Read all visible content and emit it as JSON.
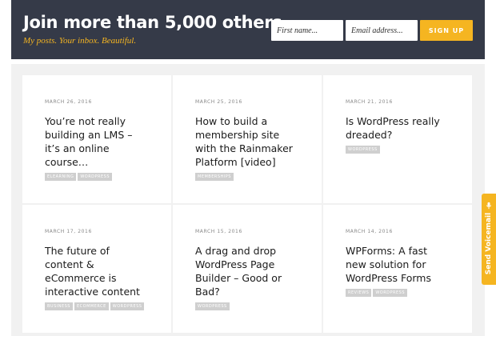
{
  "banner": {
    "title": "Join more than 5,000 others",
    "subtitle": "My posts. Your inbox. Beautiful.",
    "first_name_placeholder": "First name...",
    "email_placeholder": "Email address...",
    "signup_label": "SIGN UP",
    "background_color": "#353a48",
    "accent_color": "#f5b521"
  },
  "posts": [
    {
      "date": "MARCH 26, 2016",
      "title": "You’re not really building an LMS – it’s an online course…",
      "tags": [
        "ELEARNING",
        "WORDPRESS"
      ]
    },
    {
      "date": "MARCH 25, 2016",
      "title": "How to build a membership site with the Rainmaker Platform [video]",
      "tags": [
        "MEMBERSHIPS"
      ]
    },
    {
      "date": "MARCH 21, 2016",
      "title": "Is WordPress really dreaded?",
      "tags": [
        "WORDPRESS"
      ]
    },
    {
      "date": "MARCH 17, 2016",
      "title": "The future of content & eCommerce is interactive content",
      "tags": [
        "BUSINESS",
        "ECOMMERCE",
        "WORDPRESS"
      ]
    },
    {
      "date": "MARCH 15, 2016",
      "title": "A drag and drop WordPress Page Builder – Good or Bad?",
      "tags": [
        "WORDPRESS"
      ]
    },
    {
      "date": "MARCH 14, 2016",
      "title": "WPForms: A fast new solution for WordPress Forms",
      "tags": [
        "REVIEWS",
        "WORDPRESS"
      ]
    }
  ],
  "voicemail": {
    "label": "Send Voicemail",
    "icon": "microphone-icon"
  }
}
